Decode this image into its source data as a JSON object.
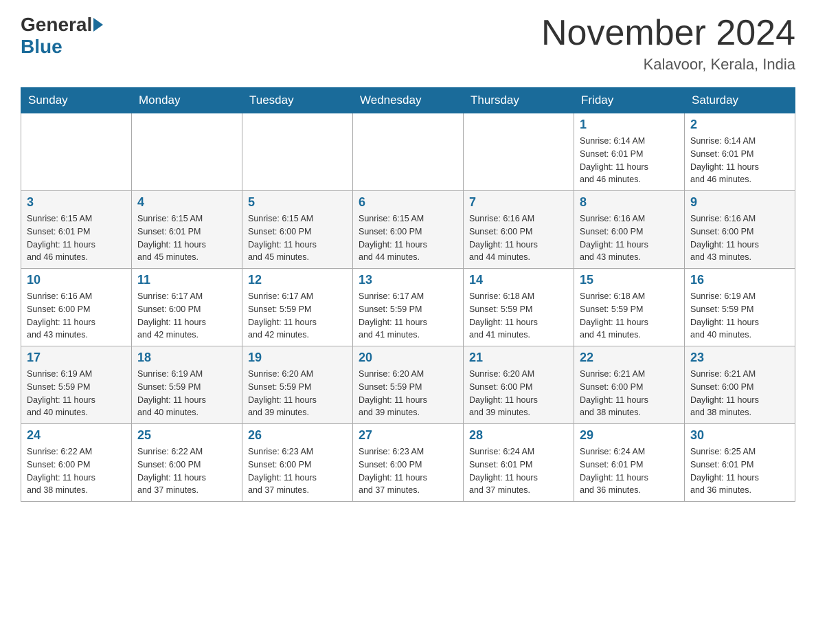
{
  "header": {
    "logo_general": "General",
    "logo_blue": "Blue",
    "month_title": "November 2024",
    "location": "Kalavoor, Kerala, India"
  },
  "weekdays": [
    "Sunday",
    "Monday",
    "Tuesday",
    "Wednesday",
    "Thursday",
    "Friday",
    "Saturday"
  ],
  "weeks": [
    [
      {
        "day": "",
        "info": ""
      },
      {
        "day": "",
        "info": ""
      },
      {
        "day": "",
        "info": ""
      },
      {
        "day": "",
        "info": ""
      },
      {
        "day": "",
        "info": ""
      },
      {
        "day": "1",
        "info": "Sunrise: 6:14 AM\nSunset: 6:01 PM\nDaylight: 11 hours\nand 46 minutes."
      },
      {
        "day": "2",
        "info": "Sunrise: 6:14 AM\nSunset: 6:01 PM\nDaylight: 11 hours\nand 46 minutes."
      }
    ],
    [
      {
        "day": "3",
        "info": "Sunrise: 6:15 AM\nSunset: 6:01 PM\nDaylight: 11 hours\nand 46 minutes."
      },
      {
        "day": "4",
        "info": "Sunrise: 6:15 AM\nSunset: 6:01 PM\nDaylight: 11 hours\nand 45 minutes."
      },
      {
        "day": "5",
        "info": "Sunrise: 6:15 AM\nSunset: 6:00 PM\nDaylight: 11 hours\nand 45 minutes."
      },
      {
        "day": "6",
        "info": "Sunrise: 6:15 AM\nSunset: 6:00 PM\nDaylight: 11 hours\nand 44 minutes."
      },
      {
        "day": "7",
        "info": "Sunrise: 6:16 AM\nSunset: 6:00 PM\nDaylight: 11 hours\nand 44 minutes."
      },
      {
        "day": "8",
        "info": "Sunrise: 6:16 AM\nSunset: 6:00 PM\nDaylight: 11 hours\nand 43 minutes."
      },
      {
        "day": "9",
        "info": "Sunrise: 6:16 AM\nSunset: 6:00 PM\nDaylight: 11 hours\nand 43 minutes."
      }
    ],
    [
      {
        "day": "10",
        "info": "Sunrise: 6:16 AM\nSunset: 6:00 PM\nDaylight: 11 hours\nand 43 minutes."
      },
      {
        "day": "11",
        "info": "Sunrise: 6:17 AM\nSunset: 6:00 PM\nDaylight: 11 hours\nand 42 minutes."
      },
      {
        "day": "12",
        "info": "Sunrise: 6:17 AM\nSunset: 5:59 PM\nDaylight: 11 hours\nand 42 minutes."
      },
      {
        "day": "13",
        "info": "Sunrise: 6:17 AM\nSunset: 5:59 PM\nDaylight: 11 hours\nand 41 minutes."
      },
      {
        "day": "14",
        "info": "Sunrise: 6:18 AM\nSunset: 5:59 PM\nDaylight: 11 hours\nand 41 minutes."
      },
      {
        "day": "15",
        "info": "Sunrise: 6:18 AM\nSunset: 5:59 PM\nDaylight: 11 hours\nand 41 minutes."
      },
      {
        "day": "16",
        "info": "Sunrise: 6:19 AM\nSunset: 5:59 PM\nDaylight: 11 hours\nand 40 minutes."
      }
    ],
    [
      {
        "day": "17",
        "info": "Sunrise: 6:19 AM\nSunset: 5:59 PM\nDaylight: 11 hours\nand 40 minutes."
      },
      {
        "day": "18",
        "info": "Sunrise: 6:19 AM\nSunset: 5:59 PM\nDaylight: 11 hours\nand 40 minutes."
      },
      {
        "day": "19",
        "info": "Sunrise: 6:20 AM\nSunset: 5:59 PM\nDaylight: 11 hours\nand 39 minutes."
      },
      {
        "day": "20",
        "info": "Sunrise: 6:20 AM\nSunset: 5:59 PM\nDaylight: 11 hours\nand 39 minutes."
      },
      {
        "day": "21",
        "info": "Sunrise: 6:20 AM\nSunset: 6:00 PM\nDaylight: 11 hours\nand 39 minutes."
      },
      {
        "day": "22",
        "info": "Sunrise: 6:21 AM\nSunset: 6:00 PM\nDaylight: 11 hours\nand 38 minutes."
      },
      {
        "day": "23",
        "info": "Sunrise: 6:21 AM\nSunset: 6:00 PM\nDaylight: 11 hours\nand 38 minutes."
      }
    ],
    [
      {
        "day": "24",
        "info": "Sunrise: 6:22 AM\nSunset: 6:00 PM\nDaylight: 11 hours\nand 38 minutes."
      },
      {
        "day": "25",
        "info": "Sunrise: 6:22 AM\nSunset: 6:00 PM\nDaylight: 11 hours\nand 37 minutes."
      },
      {
        "day": "26",
        "info": "Sunrise: 6:23 AM\nSunset: 6:00 PM\nDaylight: 11 hours\nand 37 minutes."
      },
      {
        "day": "27",
        "info": "Sunrise: 6:23 AM\nSunset: 6:00 PM\nDaylight: 11 hours\nand 37 minutes."
      },
      {
        "day": "28",
        "info": "Sunrise: 6:24 AM\nSunset: 6:01 PM\nDaylight: 11 hours\nand 37 minutes."
      },
      {
        "day": "29",
        "info": "Sunrise: 6:24 AM\nSunset: 6:01 PM\nDaylight: 11 hours\nand 36 minutes."
      },
      {
        "day": "30",
        "info": "Sunrise: 6:25 AM\nSunset: 6:01 PM\nDaylight: 11 hours\nand 36 minutes."
      }
    ]
  ]
}
